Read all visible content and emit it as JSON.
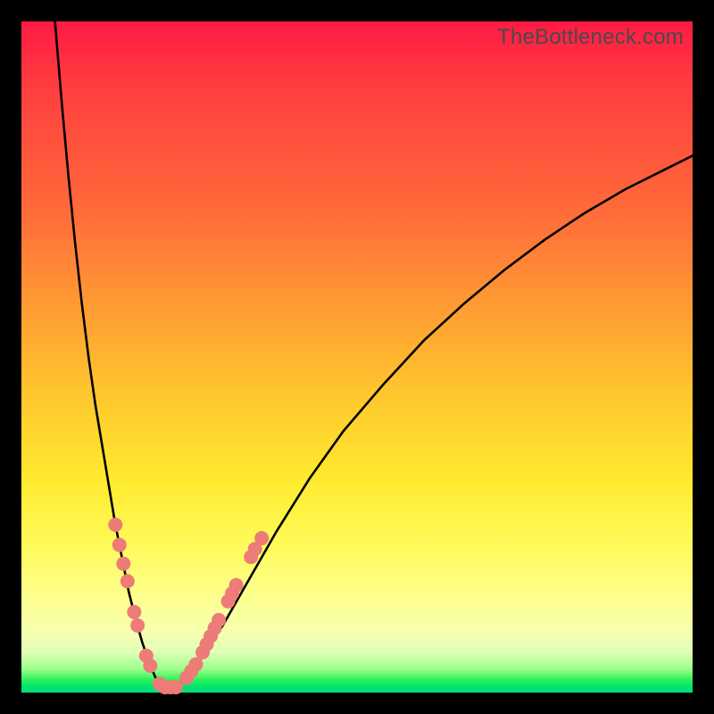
{
  "watermark": "TheBottleneck.com",
  "colors": {
    "frame": "#000000",
    "curve": "#000000",
    "marker": "#ed7b78",
    "gradient_top": "#ff1a44",
    "gradient_bottom": "#00e080"
  },
  "chart_data": {
    "type": "line",
    "title": "",
    "xlabel": "",
    "ylabel": "",
    "xlim": [
      0,
      100
    ],
    "ylim": [
      0,
      100
    ],
    "series": [
      {
        "name": "left-branch",
        "x": [
          5,
          6,
          7,
          8,
          9,
          10,
          11,
          12,
          13,
          14,
          15,
          16,
          17,
          18,
          19,
          20,
          21
        ],
        "y": [
          100,
          88,
          77,
          67,
          58,
          50,
          43,
          37,
          31,
          25,
          20,
          15,
          11,
          7.5,
          4.5,
          2.2,
          0.8
        ]
      },
      {
        "name": "right-branch",
        "x": [
          23,
          25,
          27,
          30,
          34,
          38,
          43,
          48,
          54,
          60,
          66,
          72,
          78,
          84,
          90,
          96,
          100
        ],
        "y": [
          0.8,
          2.5,
          5.5,
          10,
          17,
          24,
          32,
          39,
          46,
          52.5,
          58,
          63,
          67.5,
          71.5,
          75,
          78,
          80
        ]
      }
    ],
    "markers": [
      {
        "x": 14.0,
        "y": 25.0
      },
      {
        "x": 14.6,
        "y": 22.0
      },
      {
        "x": 15.2,
        "y": 19.2
      },
      {
        "x": 15.8,
        "y": 16.6
      },
      {
        "x": 16.8,
        "y": 12.0
      },
      {
        "x": 17.3,
        "y": 10.0
      },
      {
        "x": 18.6,
        "y": 5.5
      },
      {
        "x": 19.2,
        "y": 4.0
      },
      {
        "x": 20.6,
        "y": 1.3
      },
      {
        "x": 21.4,
        "y": 0.8
      },
      {
        "x": 22.2,
        "y": 0.8
      },
      {
        "x": 23.0,
        "y": 0.8
      },
      {
        "x": 24.6,
        "y": 2.2
      },
      {
        "x": 25.3,
        "y": 3.2
      },
      {
        "x": 26.0,
        "y": 4.2
      },
      {
        "x": 27.0,
        "y": 6.0
      },
      {
        "x": 27.6,
        "y": 7.2
      },
      {
        "x": 28.2,
        "y": 8.4
      },
      {
        "x": 28.8,
        "y": 9.6
      },
      {
        "x": 29.4,
        "y": 10.8
      },
      {
        "x": 30.8,
        "y": 13.6
      },
      {
        "x": 31.4,
        "y": 14.8
      },
      {
        "x": 32.0,
        "y": 16.0
      },
      {
        "x": 34.2,
        "y": 20.2
      },
      {
        "x": 34.8,
        "y": 21.4
      },
      {
        "x": 35.8,
        "y": 23.0
      }
    ],
    "marker_radius_px": 8
  }
}
